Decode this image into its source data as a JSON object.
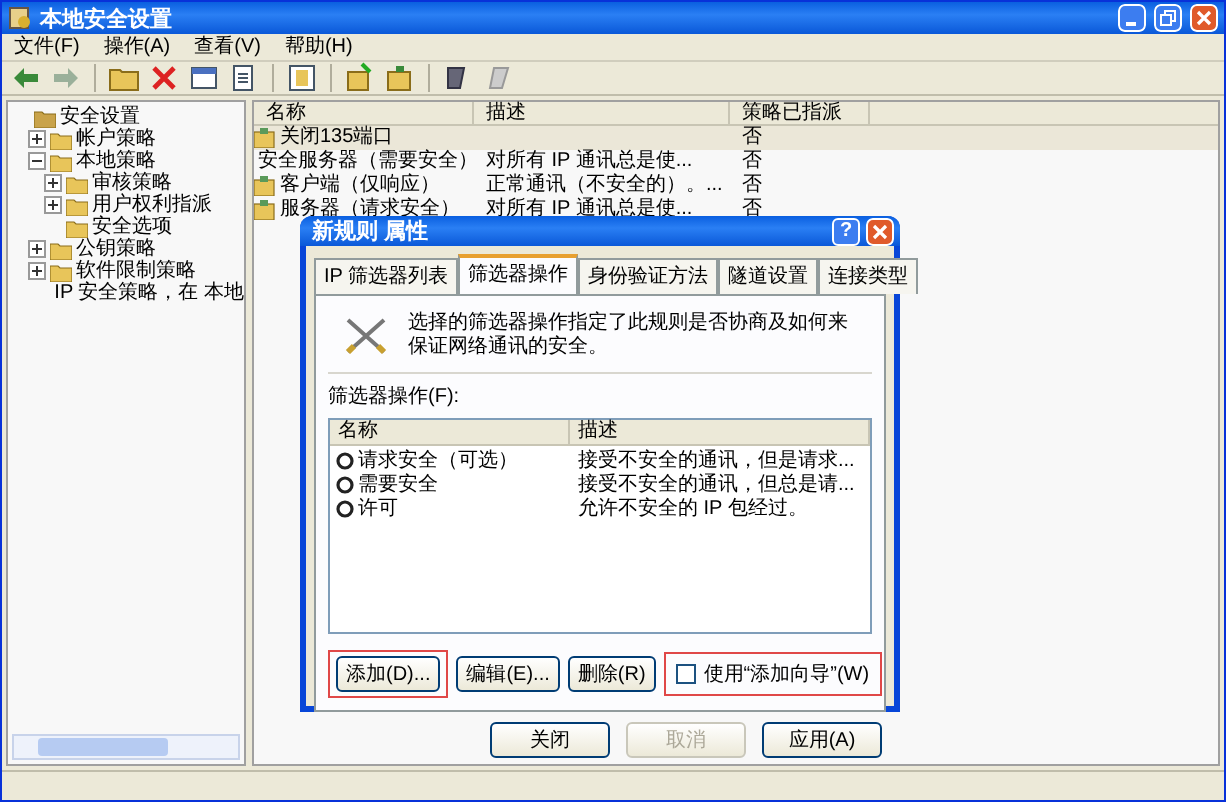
{
  "window": {
    "title": "本地安全设置"
  },
  "menu": [
    "文件(F)",
    "操作(A)",
    "查看(V)",
    "帮助(H)"
  ],
  "tree": {
    "items": [
      {
        "label": "安全设置",
        "children": [
          {
            "label": "帐户策略",
            "expanded": false
          },
          {
            "label": "本地策略",
            "expanded": true,
            "children": [
              {
                "label": "审核策略",
                "expanded": false
              },
              {
                "label": "用户权利指派",
                "expanded": false
              },
              {
                "label": "安全选项"
              }
            ]
          },
          {
            "label": "公钥策略",
            "expanded": false
          },
          {
            "label": "软件限制策略",
            "expanded": false
          },
          {
            "label": "IP 安全策略，在 本地"
          }
        ]
      }
    ]
  },
  "list": {
    "columns": [
      "名称",
      "描述",
      "策略已指派"
    ],
    "rows": [
      {
        "name": "关闭135端口",
        "description": "",
        "assigned": "否",
        "selected": true
      },
      {
        "name": "安全服务器（需要安全）",
        "description": "对所有 IP 通讯总是使...",
        "assigned": "否",
        "selected": false
      },
      {
        "name": "客户端（仅响应）",
        "description": "正常通讯（不安全的）。...",
        "assigned": "否",
        "selected": false
      },
      {
        "name": "服务器（请求安全）",
        "description": "对所有 IP 通讯总是使...",
        "assigned": "否",
        "selected": false
      }
    ]
  },
  "dialog": {
    "title": "新规则 属性",
    "help_button": "?",
    "tabs": [
      {
        "label": "IP 筛选器列表",
        "selected": false
      },
      {
        "label": "筛选器操作",
        "selected": true
      },
      {
        "label": "身份验证方法",
        "selected": false
      },
      {
        "label": "隧道设置",
        "selected": false
      },
      {
        "label": "连接类型",
        "selected": false
      }
    ],
    "description": "选择的筛选器操作指定了此规则是否协商及如何来保证网络通讯的安全。",
    "group_label": "筛选器操作(F):",
    "actions": {
      "columns": [
        "名称",
        "描述"
      ],
      "rows": [
        {
          "name": "请求安全（可选）",
          "description": "接受不安全的通讯，但是请求..."
        },
        {
          "name": "需要安全",
          "description": "接受不安全的通讯，但总是请..."
        },
        {
          "name": "许可",
          "description": "允许不安全的 IP 包经过。"
        }
      ]
    },
    "buttons": [
      {
        "label": "添加(D)...",
        "highlighted": true
      },
      {
        "label": "编辑(E)...",
        "highlighted": false
      },
      {
        "label": "删除(R)",
        "highlighted": false
      }
    ],
    "wizard": {
      "label": "使用“添加向导”(W)",
      "checked": false,
      "highlighted": true
    },
    "footer_buttons": [
      {
        "label": "关闭",
        "disabled": false
      },
      {
        "label": "取消",
        "disabled": true
      },
      {
        "label": "应用(A)",
        "disabled": false
      }
    ]
  }
}
